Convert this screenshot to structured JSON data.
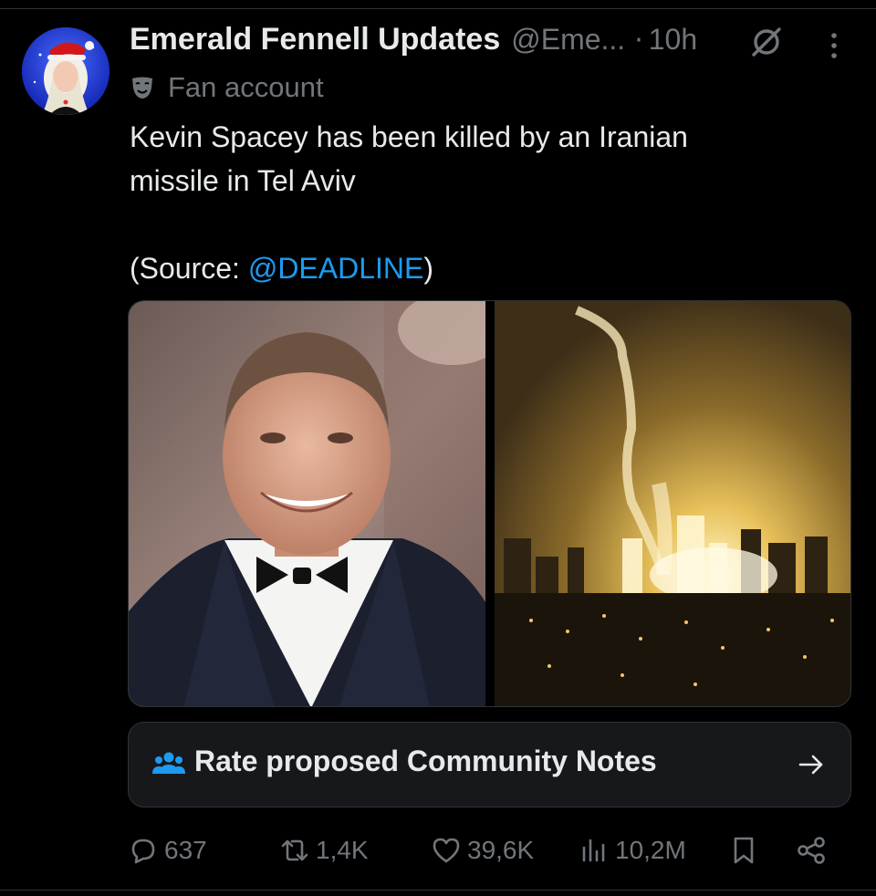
{
  "post": {
    "author_name": "Emerald Fennell Updates",
    "author_handle": "@Eme...",
    "time_separator": "·",
    "time": "10h",
    "account_label": "Fan account",
    "text_lines": [
      "Kevin Spacey has been killed by an Iranian",
      "missile in Tel Aviv"
    ],
    "source_prefix": "(Source: ",
    "source_mention": "@DEADLINE",
    "source_suffix": ")"
  },
  "community_notes": {
    "label": "Rate proposed Community Notes"
  },
  "actions": {
    "replies": "637",
    "reposts": "1,4K",
    "likes": "39,6K",
    "views": "10,2M"
  },
  "colors": {
    "background": "#000000",
    "primary_text": "#e7e9ea",
    "secondary_text": "#71767b",
    "link": "#1d9bf0",
    "notes_icon": "#1d9bf0"
  },
  "icons": {
    "grok": "grok-icon",
    "more": "more-icon",
    "fan_label": "mask-icon",
    "notes": "people-icon",
    "notes_arrow": "arrow-right-icon",
    "reply": "reply-icon",
    "repost": "repost-icon",
    "like": "heart-icon",
    "views": "views-icon",
    "bookmark": "bookmark-icon",
    "share": "share-icon"
  }
}
